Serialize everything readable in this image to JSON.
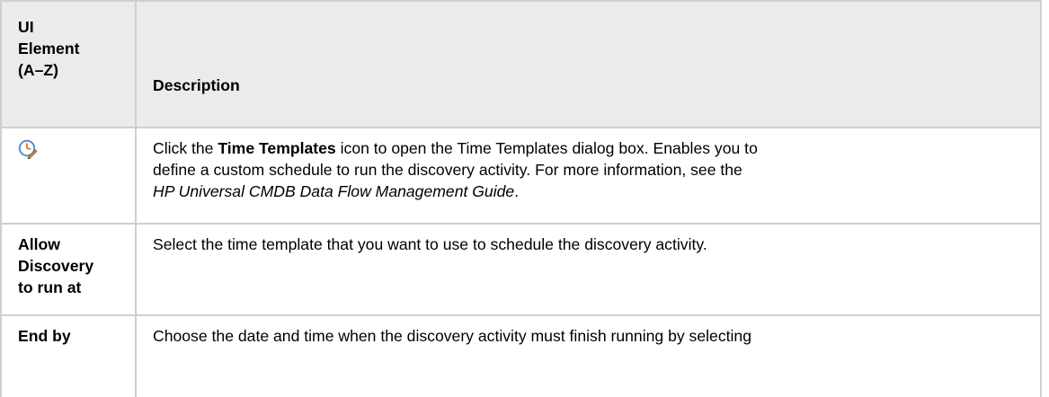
{
  "table": {
    "header": {
      "col1_lines": [
        "UI",
        "Element",
        "(A–Z)"
      ],
      "col2": "Description"
    },
    "rows": [
      {
        "element_icon": "time-templates-icon",
        "desc": {
          "pre": "Click the ",
          "bold": "Time Templates",
          "mid": " icon to open the Time Templates dialog box. Enables you to",
          "line2": "define a custom schedule to run the discovery activity. For more information, see the",
          "italic": "HP Universal CMDB Data Flow Management Guide",
          "end": "."
        }
      },
      {
        "element_lines": [
          "Allow",
          "Discovery",
          "to run at"
        ],
        "desc": "Select the time template that you want to use to schedule the discovery activity."
      },
      {
        "element_lines": [
          "End by"
        ],
        "desc": "Choose the date and time when the discovery activity must finish running by selecting"
      }
    ]
  },
  "colors": {
    "header_bg": "#ebebeb",
    "border": "#cfcfcf"
  }
}
